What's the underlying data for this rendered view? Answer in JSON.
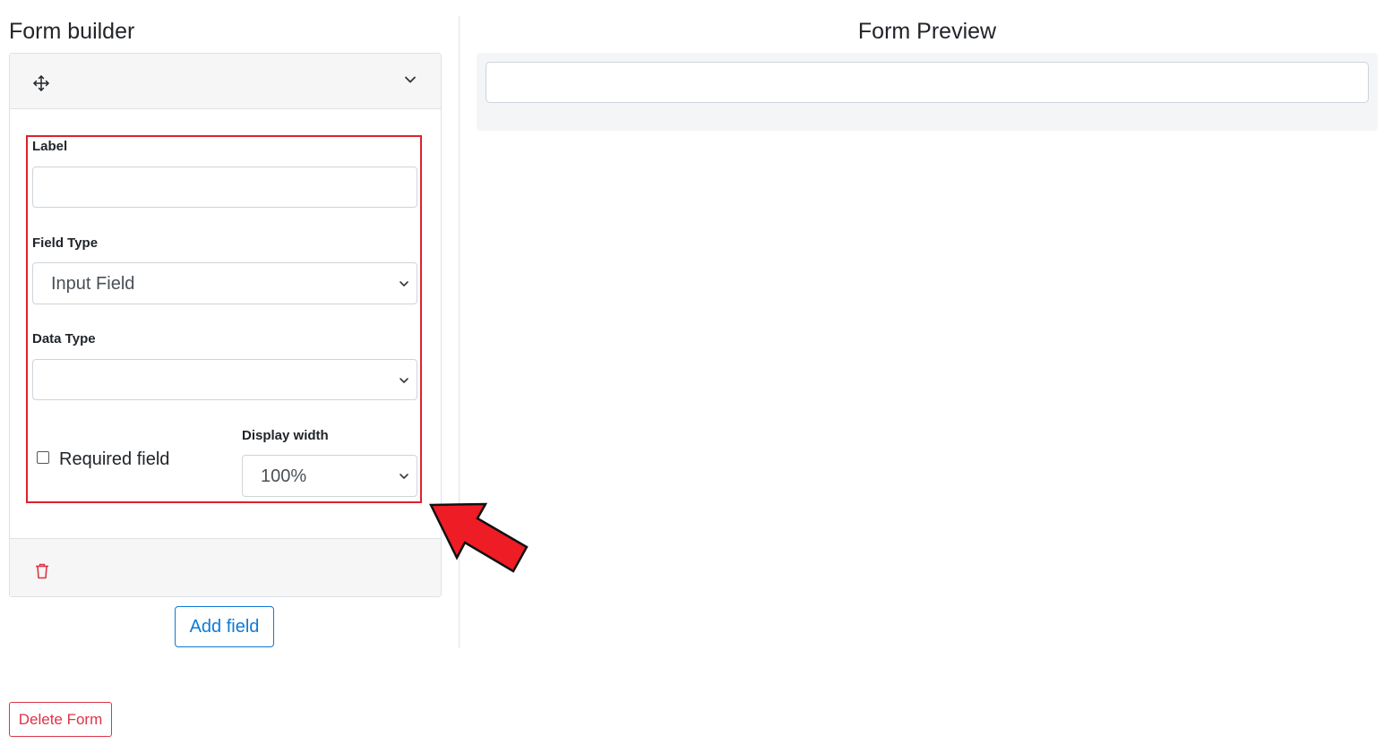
{
  "builder": {
    "title": "Form builder",
    "field": {
      "label_title": "Label",
      "label_value": "",
      "field_type_title": "Field Type",
      "field_type_value": "Input Field",
      "data_type_title": "Data Type",
      "data_type_value": "",
      "required_label": "Required field",
      "required_checked": false,
      "display_width_title": "Display width",
      "display_width_value": "100%"
    },
    "add_field_label": "Add field",
    "delete_form_label": "Delete Form"
  },
  "preview": {
    "title": "Form Preview",
    "input_value": ""
  },
  "icons": {
    "move": "move-arrows-icon",
    "collapse": "chevron-down-icon",
    "delete": "trash-icon",
    "annotation": "arrow-pointer-icon"
  },
  "colors": {
    "primary": "#0d7ad8",
    "danger": "#dc3545",
    "highlight": "#e0202e",
    "annotation_fill": "#ee1c25"
  }
}
